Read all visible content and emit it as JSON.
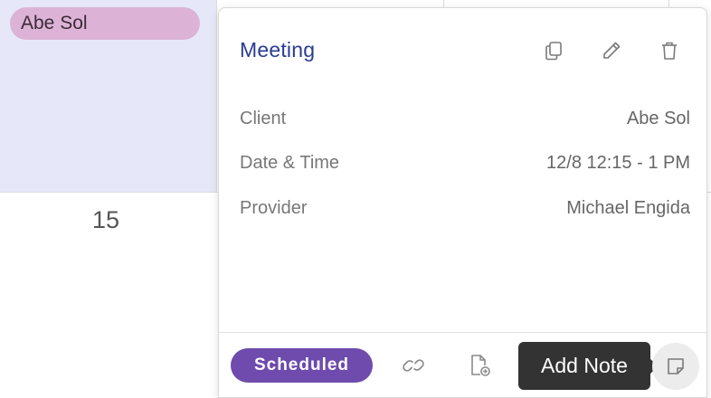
{
  "calendar": {
    "event_pill": "Abe Sol",
    "day_number": "15"
  },
  "popover": {
    "title": "Meeting",
    "actions": {
      "copy_icon": "copy-icon",
      "edit_icon": "pencil-icon",
      "delete_icon": "trash-icon"
    },
    "details": [
      {
        "label": "Client",
        "value": "Abe Sol"
      },
      {
        "label": "Date & Time",
        "value": "12/8 12:15 - 1 PM"
      },
      {
        "label": "Provider",
        "value": "Michael Engida"
      }
    ],
    "footer": {
      "status": "Scheduled",
      "link_icon": "link-icon",
      "file_add_icon": "file-plus-icon",
      "tooltip": "Add Note",
      "note_icon": "note-icon"
    }
  },
  "colors": {
    "title": "#2a3b94",
    "status_badge": "#6e4bad",
    "event_pill": "#dcb3d6",
    "calendar_highlight": "#e7e7fa",
    "tooltip_bg": "#333333"
  }
}
